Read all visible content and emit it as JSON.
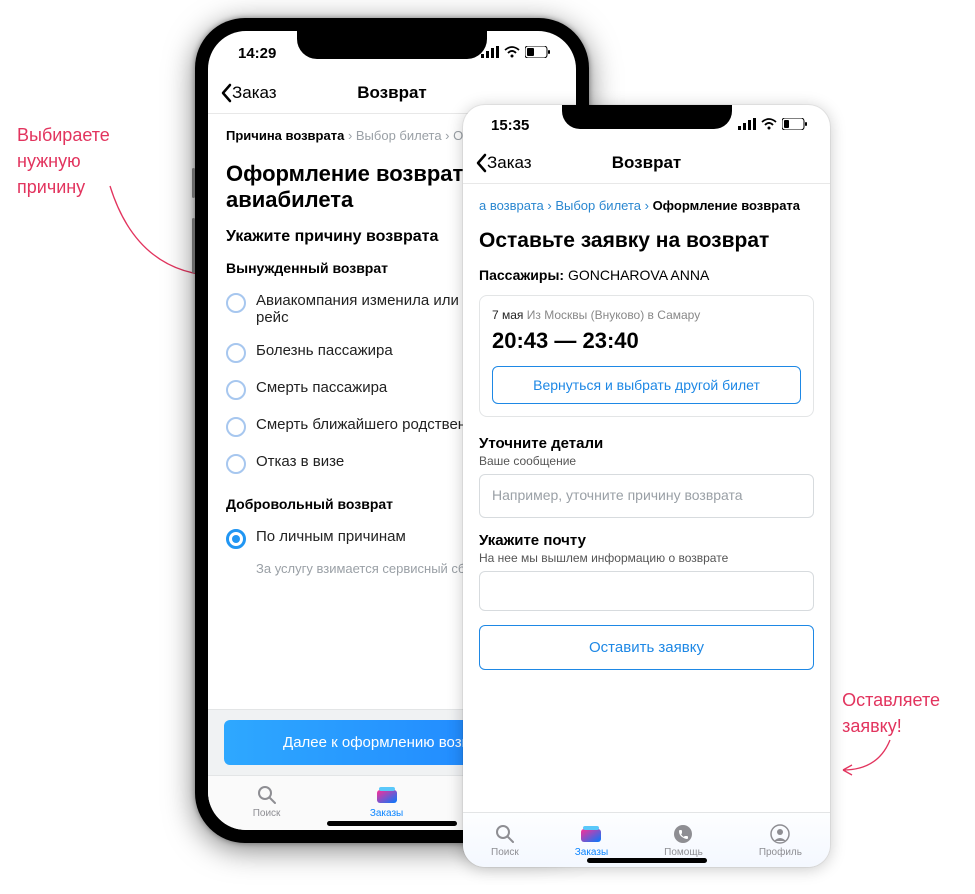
{
  "annotations": {
    "left": "Выбираете\nнужную\nпричину",
    "right": "Оставляете\nзаявку!"
  },
  "phone1": {
    "status_time": "14:29",
    "nav_back": "Заказ",
    "nav_title": "Возврат",
    "breadcrumb": {
      "step1": "Причина возврата",
      "step2": "Выбор билета",
      "step3": "Оф..."
    },
    "h1": "Оформление возврата авиабилета",
    "sub": "Укажите причину возврата",
    "group1_title": "Вынужденный возврат",
    "group1_options": [
      "Авиакомпания изменила или отменила рейс",
      "Болезнь пассажира",
      "Смерть пассажира",
      "Смерть ближайшего родственника",
      "Отказ в визе"
    ],
    "group2_title": "Добровольный возврат",
    "group2_option": "По личным причинам",
    "group2_note": "За услугу взимается сервисный сбор",
    "cta": "Далее к оформлению возврата",
    "tabs": {
      "t1": "Поиск",
      "t2": "Заказы",
      "t3": "Помощь"
    }
  },
  "phone2": {
    "status_time": "15:35",
    "nav_back": "Заказ",
    "nav_title": "Возврат",
    "breadcrumb": {
      "c1": "а возврата",
      "c2": "Выбор билета",
      "c3": "Оформление возврата"
    },
    "h1": "Оставьте заявку на возврат",
    "pax_label": "Пассажиры:",
    "pax_name": "GONCHAROVA ANNA",
    "card": {
      "date": "7 мая",
      "route": "Из Москвы (Внуково) в Самару",
      "time": "20:43 — 23:40",
      "btn": "Вернуться и выбрать другой билет"
    },
    "details_title": "Уточните детали",
    "details_sub": "Ваше сообщение",
    "details_placeholder": "Например, уточните причину возврата",
    "email_title": "Укажите почту",
    "email_sub": "На нее мы вышлем информацию о возврате",
    "cta": "Оставить заявку",
    "tabs": {
      "t1": "Поиск",
      "t2": "Заказы",
      "t3": "Помощь",
      "t4": "Профиль"
    }
  }
}
